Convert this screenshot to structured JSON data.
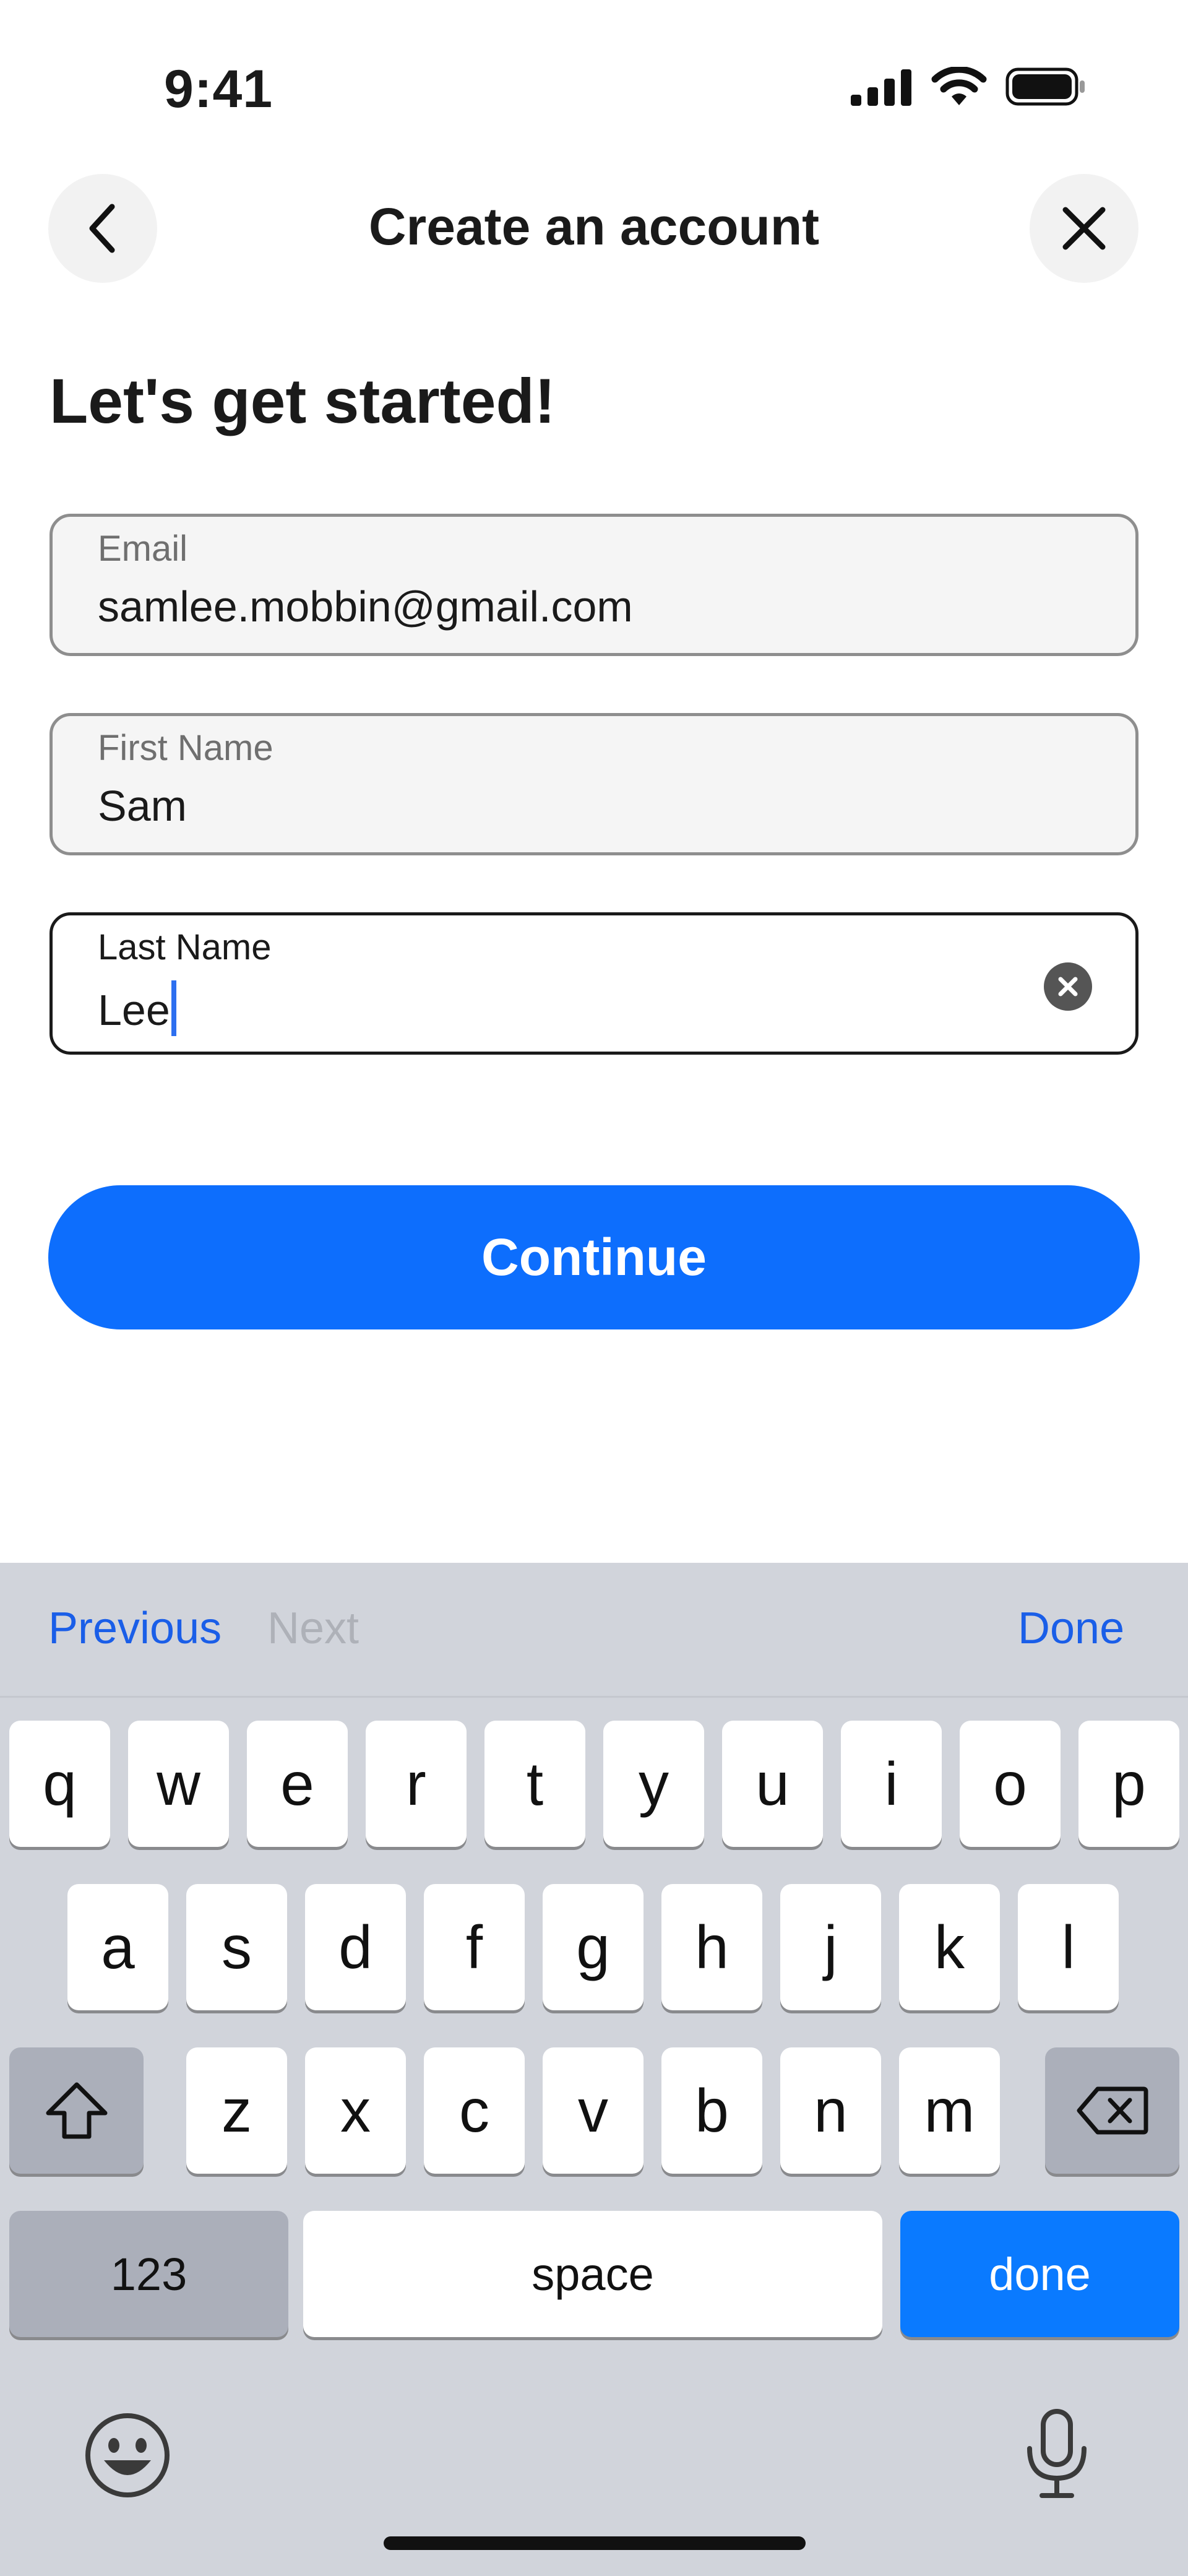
{
  "status_bar": {
    "time": "9:41",
    "icons": [
      "cellular-signal-icon",
      "wifi-icon",
      "battery-icon"
    ]
  },
  "header": {
    "title": "Create an account",
    "back_icon": "chevron-left-icon",
    "close_icon": "close-icon"
  },
  "heading": "Let's get started!",
  "fields": {
    "email": {
      "label": "Email",
      "value": "samlee.mobbin@gmail.com"
    },
    "first_name": {
      "label": "First Name",
      "value": "Sam"
    },
    "last_name": {
      "label": "Last Name",
      "value": "Lee",
      "clear_icon": "clear-circle-icon"
    }
  },
  "continue_label": "Continue",
  "keyboard": {
    "accessory": {
      "previous": "Previous",
      "next": "Next",
      "done": "Done"
    },
    "row1": [
      "q",
      "w",
      "e",
      "r",
      "t",
      "y",
      "u",
      "i",
      "o",
      "p"
    ],
    "row2": [
      "a",
      "s",
      "d",
      "f",
      "g",
      "h",
      "j",
      "k",
      "l"
    ],
    "row3": [
      "z",
      "x",
      "c",
      "v",
      "b",
      "n",
      "m"
    ],
    "numbers_key": "123",
    "space_key": "space",
    "done_key": "done",
    "shift_icon": "shift-icon",
    "backspace_icon": "backspace-icon",
    "emoji_icon": "emoji-icon",
    "mic_icon": "microphone-icon"
  },
  "colors": {
    "accent": "#0d6efd",
    "link": "#1a5ee8",
    "keyboard_bg": "#d1d4db"
  }
}
